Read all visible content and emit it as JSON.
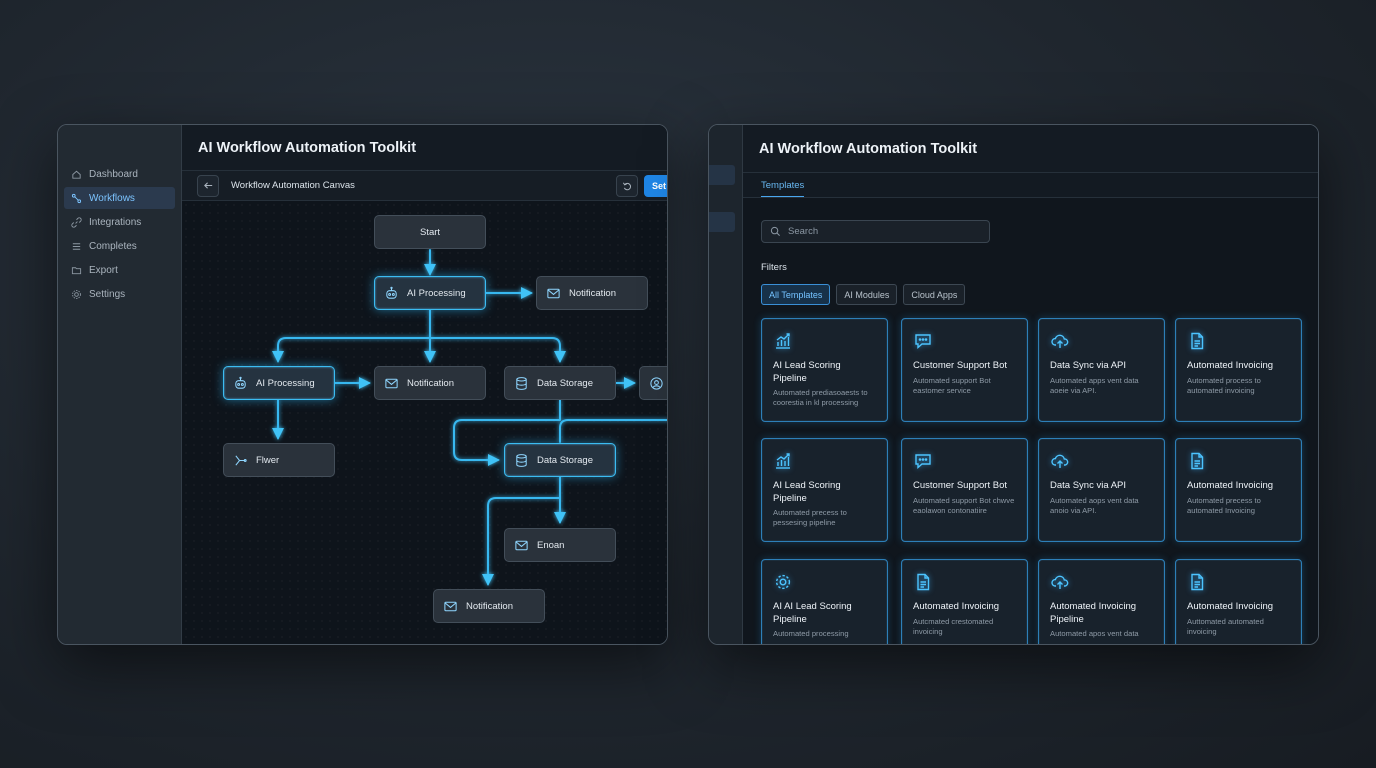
{
  "left_window": {
    "title": "AI Workflow Automation Toolkit",
    "sidebar": {
      "items": [
        {
          "label": "Dashboard",
          "icon": "home-icon",
          "active": false
        },
        {
          "label": "Workflows",
          "icon": "workflow-icon",
          "active": true
        },
        {
          "label": "Integrations",
          "icon": "link-icon",
          "active": false
        },
        {
          "label": "Completes",
          "icon": "list-icon",
          "active": false
        },
        {
          "label": "Export",
          "icon": "folder-icon",
          "active": false
        },
        {
          "label": "Settings",
          "icon": "gear-icon",
          "active": false
        }
      ]
    },
    "toolbar": {
      "canvas_title": "Workflow Automation Canvas",
      "set_label": "Set"
    },
    "nodes": {
      "start": "Start",
      "ai_processing_top": "AI Processing",
      "notification_top": "Notification",
      "ai_processing_left": "AI Processing",
      "notification_mid": "Notification",
      "data_storage_mid": "Data Storage",
      "flow": "Flwer",
      "data_storage_lower": "Data Storage",
      "email": "Enoan",
      "notification_bottom": "Notification"
    }
  },
  "right_window": {
    "title": "AI Workflow Automation Toolkit",
    "tab": "Templates",
    "search_placeholder": "Search",
    "filters_label": "Filters",
    "filters": [
      "All Templates",
      "AI Modules",
      "Cloud Apps"
    ],
    "active_filter": "All Templates",
    "cards": [
      {
        "icon": "chart-icon",
        "title": "AI Lead Scoring Pipeline",
        "desc": "Automated prediasoaests to coorestia in kl processing"
      },
      {
        "icon": "chat-icon",
        "title": "Customer Support Bot",
        "desc": "Automated support Bot eastomer service"
      },
      {
        "icon": "cloud-upload-icon",
        "title": "Data Sync via API",
        "desc": "Automated apps vent data aoeie via API."
      },
      {
        "icon": "document-icon",
        "title": "Automated Invoicing",
        "desc": "Automated process to automated invoicing"
      },
      {
        "icon": "chart-icon",
        "title": "AI Lead Scoring Pipeline",
        "desc": "Automated precess to pessesing pipeline"
      },
      {
        "icon": "chat-icon",
        "title": "Customer Support Bot",
        "desc": "Automated support Bot chwve eaolawon contonatiire"
      },
      {
        "icon": "cloud-upload-icon",
        "title": "Data Sync via API",
        "desc": "Automated aops vent data anoio via API."
      },
      {
        "icon": "document-icon",
        "title": "Automated Invoicing",
        "desc": "Automated precess to automated Invoicing"
      },
      {
        "icon": "gear-icon",
        "title": "AI AI Lead Scoring Pipeline",
        "desc": "Automated processing"
      },
      {
        "icon": "document-icon",
        "title": "Automated Invoicing",
        "desc": "Autcmated crestomated invoicing"
      },
      {
        "icon": "cloud-upload-icon",
        "title": "Automated Invoicing Pipeline",
        "desc": "Automated apos vent data"
      },
      {
        "icon": "document-icon",
        "title": "Automated Invoicing",
        "desc": "Auttomated automated invoicing"
      }
    ]
  },
  "colors": {
    "accent": "#3bbcf2",
    "primary_button": "#1f86e6",
    "active_tab": "#68b8f2"
  }
}
